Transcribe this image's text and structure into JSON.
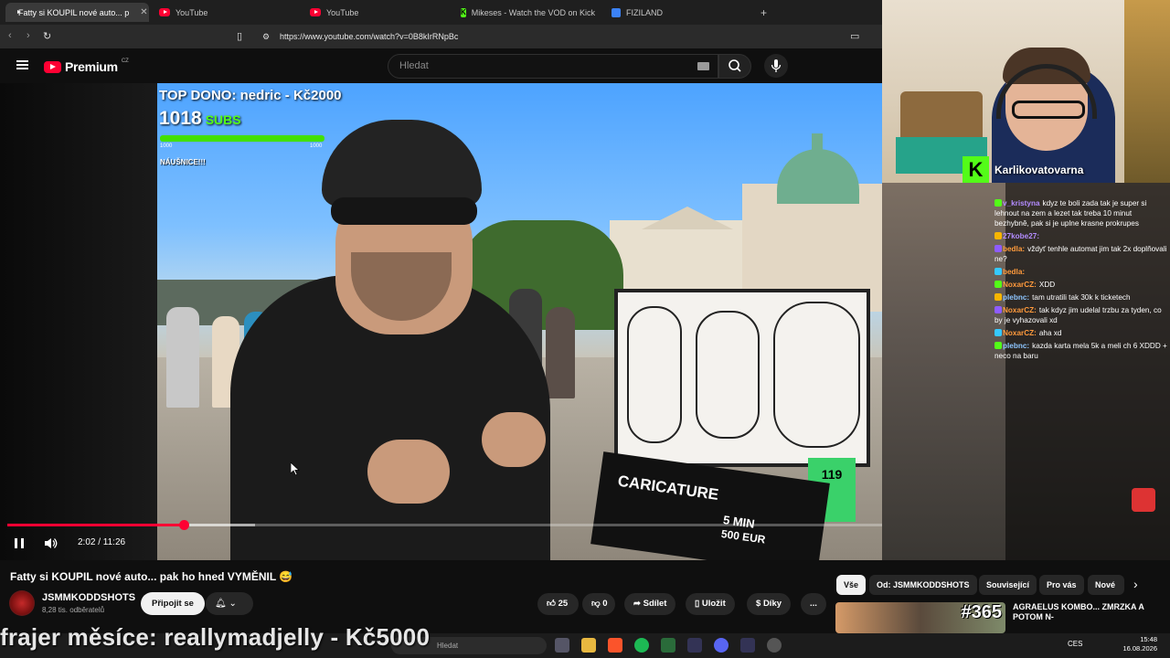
{
  "browser": {
    "tabs": [
      {
        "label": "Fatty si KOUPIL nové auto... p",
        "icon": "youtube-favicon",
        "active": true
      },
      {
        "label": "YouTube",
        "icon": "youtube-favicon"
      },
      {
        "label": "YouTube",
        "icon": "youtube-favicon"
      },
      {
        "label": "Mikeses - Watch the VOD on Kick",
        "icon": "kick-favicon"
      },
      {
        "label": "FIZILAND",
        "icon": "fiziland-favicon"
      }
    ],
    "new_tab": "+",
    "url": "https://www.youtube.com/watch?v=0B8kIrRNpBc"
  },
  "youtube": {
    "logo_text": "Premium",
    "region": "CZ",
    "search_placeholder": "Hledat"
  },
  "player": {
    "overlay_dono": "TOP DONO: nedric - Kč2000",
    "subs_count": "1018",
    "subs_label": "SUBS",
    "subs_min": "1000",
    "subs_max": "1000",
    "subs_goal_fill": 1.0,
    "note": "NÁUŠNICE!!!",
    "time": "2:02 / 11:26",
    "played_fraction": 0.178,
    "sign_text": "CARICATURE",
    "sign_price": "5 MIN",
    "sign_price2": "500 EUR",
    "card_number": "119"
  },
  "stream": {
    "channel": "Karlikovatovarna",
    "chat": [
      {
        "time": "15:46",
        "user": "v_kristyna",
        "color": "#b38cff",
        "text": "kdyz te boli zada tak je super si lehnout na zem a lezet tak treba 10 minut bezhybně, pak si je uplne krasne prokrupes"
      },
      {
        "time": "15:46",
        "user": "27kobe27:",
        "color": "#b38cff",
        "text": ""
      },
      {
        "time": "15:46",
        "user": "bedla:",
        "color": "#ff9a3c",
        "text": "vždyť tenhle automat jim tak 2x doplňovali ne?"
      },
      {
        "time": "15:46",
        "user": "bedla:",
        "color": "#ff9a3c",
        "text": ""
      },
      {
        "time": "15:47",
        "user": "NoxarCZ:",
        "color": "#ff9a3c",
        "text": "XDD"
      },
      {
        "time": "15:47",
        "user": "plebnc:",
        "color": "#8ec6ff",
        "text": "tam utratili tak 30k k ticketech"
      },
      {
        "time": "15:47",
        "user": "NoxarCZ:",
        "color": "#ff9a3c",
        "text": "tak kdyz jim udelal trzbu za tyden, co by je vyhazovali xd"
      },
      {
        "time": "15:47",
        "user": "NoxarCZ:",
        "color": "#ff9a3c",
        "text": "aha xd"
      },
      {
        "time": "15:47",
        "user": "plebnc:",
        "color": "#8ec6ff",
        "text": "kazda karta mela 5k a meli ch 6 XDDD + neco na baru"
      }
    ]
  },
  "video": {
    "title": "Fatty si KOUPIL nové auto... pak ho hned VYMĚNIL 😅",
    "channel": "JSMMKODDSHOTS",
    "subscribers": "8,28 tis. odběratelů",
    "subscribe": "Připojit se",
    "likes": "25",
    "dislikes": "0",
    "share": "Sdílet",
    "save": "Uložit",
    "thanks": "Díky",
    "more": "..."
  },
  "filters": [
    "Vše",
    "Od: JSMMKODDSHOTS",
    "Související",
    "Pro vás",
    "Nové"
  ],
  "suggested": {
    "number": "#365",
    "title": "AGRAELUS KOMBO... ZMRZKA A POTOM N-"
  },
  "caption": "frajer měsíce: reallymadjelly - Kč5000",
  "taskbar": {
    "search": "Hledat",
    "lang": "CES",
    "time": "15:48",
    "date": "16.08.2026"
  }
}
